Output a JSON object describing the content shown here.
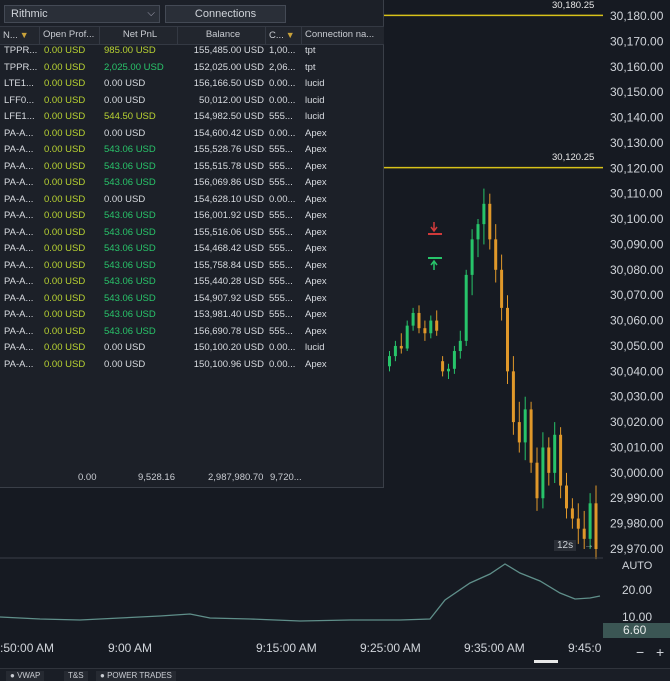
{
  "account_panel": {
    "broker_select": "Rithmic",
    "connections_button": "Connections",
    "columns": [
      "N...",
      "Open Prof...",
      "Net PnL",
      "Balance",
      "C...",
      "Connection na..."
    ],
    "rows": [
      {
        "name": "TPPR...",
        "open": "0.00 USD",
        "net": "985.00 USD",
        "net_color": "lime",
        "balance": "155,485.00 USD",
        "c": "1,00...",
        "conn": "tpt"
      },
      {
        "name": "TPPR...",
        "open": "0.00 USD",
        "net": "2,025.00 USD",
        "net_color": "green",
        "balance": "152,025.00 USD",
        "c": "2,06...",
        "conn": "tpt"
      },
      {
        "name": "LTE1...",
        "open": "0.00 USD",
        "net": "0.00 USD",
        "net_color": "white",
        "balance": "156,166.50 USD",
        "c": "0.00...",
        "conn": "lucid"
      },
      {
        "name": "LFF0...",
        "open": "0.00 USD",
        "net": "0.00 USD",
        "net_color": "white",
        "balance": "50,012.00 USD",
        "c": "0.00...",
        "conn": "lucid"
      },
      {
        "name": "LFE1...",
        "open": "0.00 USD",
        "net": "544.50 USD",
        "net_color": "lime",
        "balance": "154,982.50 USD",
        "c": "555...",
        "conn": "lucid"
      },
      {
        "name": "PA-A...",
        "open": "0.00 USD",
        "net": "0.00 USD",
        "net_color": "white",
        "balance": "154,600.42 USD",
        "c": "0.00...",
        "conn": "Apex"
      },
      {
        "name": "PA-A...",
        "open": "0.00 USD",
        "net": "543.06 USD",
        "net_color": "green",
        "balance": "155,528.76 USD",
        "c": "555...",
        "conn": "Apex"
      },
      {
        "name": "PA-A...",
        "open": "0.00 USD",
        "net": "543.06 USD",
        "net_color": "green",
        "balance": "155,515.78 USD",
        "c": "555...",
        "conn": "Apex"
      },
      {
        "name": "PA-A...",
        "open": "0.00 USD",
        "net": "543.06 USD",
        "net_color": "green",
        "balance": "156,069.86 USD",
        "c": "555...",
        "conn": "Apex"
      },
      {
        "name": "PA-A...",
        "open": "0.00 USD",
        "net": "0.00 USD",
        "net_color": "white",
        "balance": "154,628.10 USD",
        "c": "0.00...",
        "conn": "Apex"
      },
      {
        "name": "PA-A...",
        "open": "0.00 USD",
        "net": "543.06 USD",
        "net_color": "green",
        "balance": "156,001.92 USD",
        "c": "555...",
        "conn": "Apex"
      },
      {
        "name": "PA-A...",
        "open": "0.00 USD",
        "net": "543.06 USD",
        "net_color": "green",
        "balance": "155,516.06 USD",
        "c": "555...",
        "conn": "Apex"
      },
      {
        "name": "PA-A...",
        "open": "0.00 USD",
        "net": "543.06 USD",
        "net_color": "green",
        "balance": "154,468.42 USD",
        "c": "555...",
        "conn": "Apex"
      },
      {
        "name": "PA-A...",
        "open": "0.00 USD",
        "net": "543.06 USD",
        "net_color": "green",
        "balance": "155,758.84 USD",
        "c": "555...",
        "conn": "Apex"
      },
      {
        "name": "PA-A...",
        "open": "0.00 USD",
        "net": "543.06 USD",
        "net_color": "green",
        "balance": "155,440.28 USD",
        "c": "555...",
        "conn": "Apex"
      },
      {
        "name": "PA-A...",
        "open": "0.00 USD",
        "net": "543.06 USD",
        "net_color": "green",
        "balance": "154,907.92 USD",
        "c": "555...",
        "conn": "Apex"
      },
      {
        "name": "PA-A...",
        "open": "0.00 USD",
        "net": "543.06 USD",
        "net_color": "green",
        "balance": "153,981.40 USD",
        "c": "555...",
        "conn": "Apex"
      },
      {
        "name": "PA-A...",
        "open": "0.00 USD",
        "net": "543.06 USD",
        "net_color": "green",
        "balance": "156,690.78 USD",
        "c": "555...",
        "conn": "Apex"
      },
      {
        "name": "PA-A...",
        "open": "0.00 USD",
        "net": "0.00 USD",
        "net_color": "white",
        "balance": "150,100.20 USD",
        "c": "0.00...",
        "conn": "lucid"
      },
      {
        "name": "PA-A...",
        "open": "0.00 USD",
        "net": "0.00 USD",
        "net_color": "white",
        "balance": "150,100.96 USD",
        "c": "0.00...",
        "conn": "Apex"
      }
    ],
    "totals": {
      "open": "0.00",
      "net": "9,528.16",
      "balance": "2,987,980.70",
      "c": "9,720..."
    }
  },
  "price_axis": {
    "labels": [
      "30,180.00",
      "30,170.00",
      "30,160.00",
      "30,150.00",
      "30,140.00",
      "30,130.00",
      "30,120.00",
      "30,110.00",
      "30,100.00",
      "30,090.00",
      "30,080.00",
      "30,070.00",
      "30,060.00",
      "30,050.00",
      "30,040.00",
      "30,030.00",
      "30,020.00",
      "30,010.00",
      "30,000.00",
      "29,990.00",
      "29,980.00",
      "29,970.00"
    ],
    "level_lines": [
      "30,180.25",
      "30,120.25"
    ]
  },
  "indicator": {
    "mode_label": "AUTO",
    "labels": [
      "20.00",
      "10.00"
    ],
    "current_value": "6.60"
  },
  "time_axis": {
    "labels": [
      ":50:00 AM",
      "9:00 AM",
      "9:15:00 AM",
      "9:25:00 AM",
      "9:35:00 AM",
      "9:45:0"
    ]
  },
  "bar_timer": "12s",
  "bottom_tabs": [
    "VWAP",
    "T&S",
    "POWER TRADES"
  ],
  "colors": {
    "up": "#27c46a",
    "down": "#e0982a",
    "level": "#d8c21a",
    "indicator": "#5f8f8a",
    "lime": "#b9d332",
    "green": "#29c46a"
  },
  "chart_data": {
    "type": "candlestick",
    "ylim": [
      29965,
      30185
    ],
    "candles": [
      [
        30042,
        30048,
        30040,
        30046
      ],
      [
        30046,
        30052,
        30044,
        30050
      ],
      [
        30050,
        30055,
        30047,
        30049
      ],
      [
        30049,
        30060,
        30048,
        30058
      ],
      [
        30058,
        30065,
        30056,
        30063
      ],
      [
        30063,
        30066,
        30055,
        30057
      ],
      [
        30057,
        30060,
        30052,
        30055
      ],
      [
        30055,
        30062,
        30053,
        30060
      ],
      [
        30060,
        30064,
        30054,
        30056
      ],
      [
        30044,
        30046,
        30038,
        30040
      ],
      [
        30040,
        30043,
        30037,
        30041
      ],
      [
        30041,
        30050,
        30039,
        30048
      ],
      [
        30048,
        30056,
        30045,
        30052
      ],
      [
        30052,
        30080,
        30050,
        30078
      ],
      [
        30078,
        30096,
        30070,
        30092
      ],
      [
        30092,
        30100,
        30085,
        30098
      ],
      [
        30098,
        30112,
        30090,
        30106
      ],
      [
        30106,
        30110,
        30088,
        30092
      ],
      [
        30092,
        30098,
        30075,
        30080
      ],
      [
        30080,
        30086,
        30060,
        30065
      ],
      [
        30065,
        30070,
        30035,
        30040
      ],
      [
        30040,
        30046,
        30015,
        30020
      ],
      [
        30020,
        30028,
        30008,
        30012
      ],
      [
        30012,
        30030,
        30005,
        30025
      ],
      [
        30025,
        30028,
        30000,
        30004
      ],
      [
        30004,
        30010,
        29985,
        29990
      ],
      [
        29990,
        30016,
        29986,
        30010
      ],
      [
        30010,
        30014,
        29995,
        30000
      ],
      [
        30000,
        30020,
        29996,
        30015
      ],
      [
        30015,
        30018,
        29990,
        29995
      ],
      [
        29995,
        30000,
        29982,
        29986
      ],
      [
        29986,
        29990,
        29978,
        29982
      ],
      [
        29982,
        29988,
        29972,
        29978
      ],
      [
        29978,
        29985,
        29970,
        29974
      ],
      [
        29974,
        29992,
        29970,
        29988
      ],
      [
        29988,
        29995,
        29966,
        29970
      ]
    ]
  }
}
